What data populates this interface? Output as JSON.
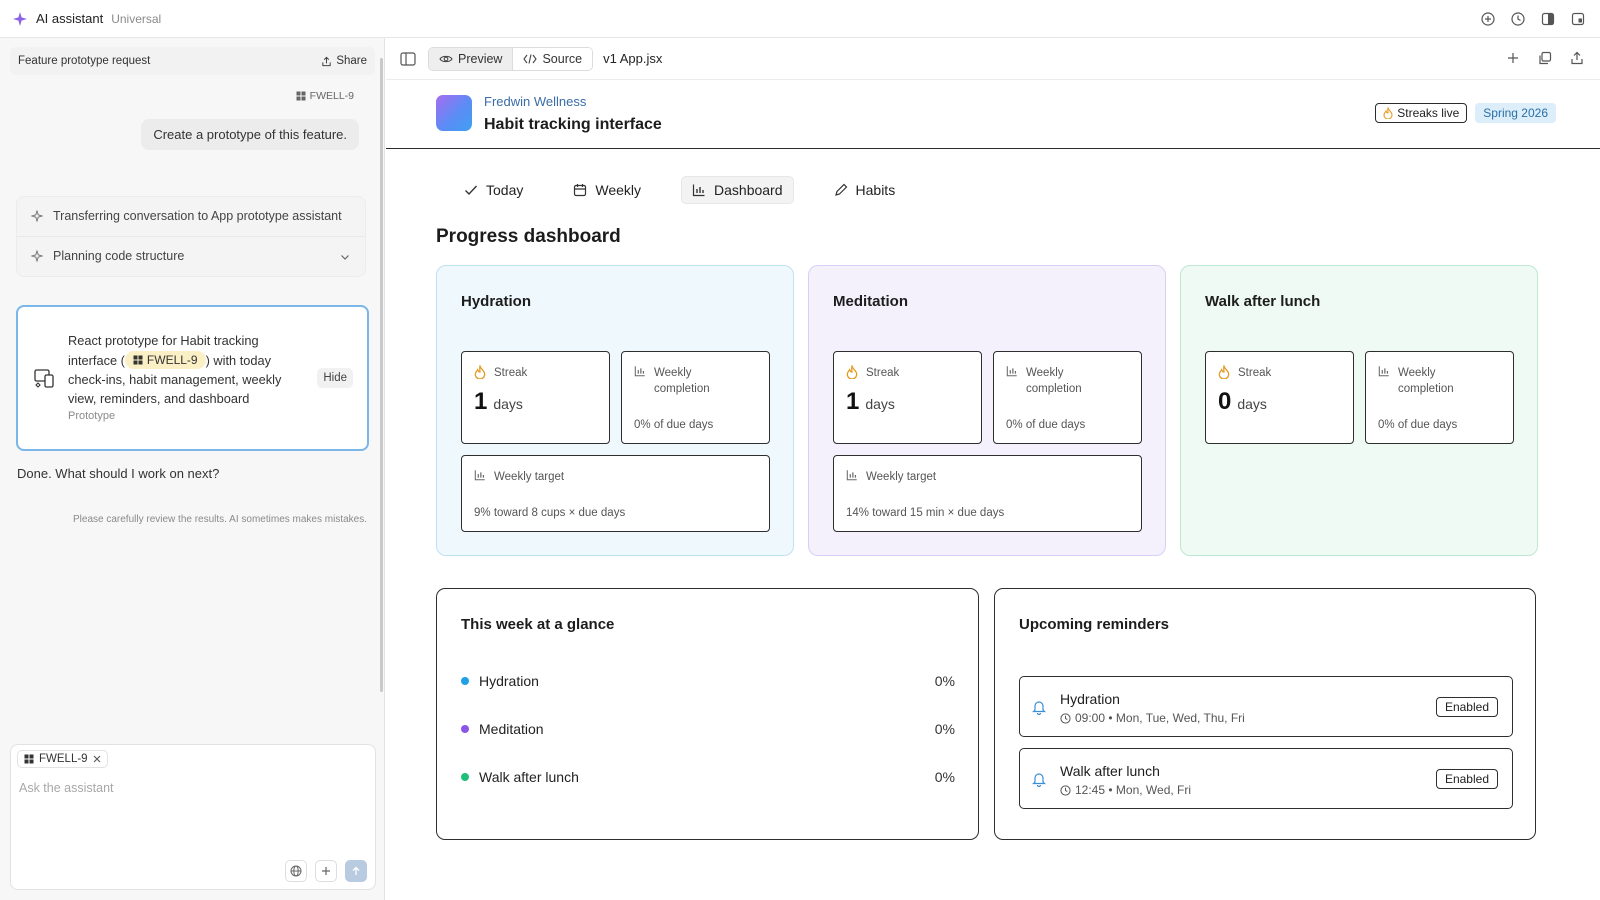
{
  "app": {
    "title": "AI assistant",
    "subtitle": "Universal"
  },
  "sidebar": {
    "conversation_title": "Feature prototype request",
    "share_label": "Share",
    "ticket_tag": "FWELL-9",
    "user_message": "Create a prototype of this feature.",
    "steps": [
      {
        "label": "Transferring conversation to App prototype assistant"
      },
      {
        "label": "Planning code structure"
      }
    ],
    "prototype_card": {
      "text_before": "React prototype for Habit tracking interface (",
      "tag": "FWELL-9",
      "text_after": ") with today check-ins, habit management, weekly view, reminders, and dashboard",
      "type_label": "Prototype",
      "hide_label": "Hide"
    },
    "assistant_reply": "Done. What should I work on next?",
    "disclaimer": "Please carefully review the results. AI sometimes makes mistakes.",
    "composer": {
      "chip": "FWELL-9",
      "placeholder": "Ask the assistant"
    }
  },
  "toolbar": {
    "preview_label": "Preview",
    "source_label": "Source",
    "file_name": "v1 App.jsx"
  },
  "app_header": {
    "org": "Fredwin Wellness",
    "title": "Habit tracking interface",
    "badge_streaks": "Streaks live",
    "badge_season": "Spring 2026"
  },
  "tabs": [
    {
      "label": "Today",
      "icon": "check-icon"
    },
    {
      "label": "Weekly",
      "icon": "calendar-icon"
    },
    {
      "label": "Dashboard",
      "icon": "bar-chart-icon",
      "active": true
    },
    {
      "label": "Habits",
      "icon": "pencil-icon"
    }
  ],
  "dashboard": {
    "title": "Progress dashboard",
    "streak_label": "Streak",
    "days_label": "days",
    "weekly_label": "Weekly completion",
    "target_label": "Weekly target",
    "habits": [
      {
        "name": "Hydration",
        "streak": "1",
        "weekly": "0% of due days",
        "target": "9% toward 8 cups × due days"
      },
      {
        "name": "Meditation",
        "streak": "1",
        "weekly": "0% of due days",
        "target": "14% toward 15 min × due days"
      },
      {
        "name": "Walk after lunch",
        "streak": "0",
        "weekly": "0% of due days"
      }
    ],
    "glance": {
      "title": "This week at a glance",
      "rows": [
        {
          "name": "Hydration",
          "pct": "0%",
          "color": "#1ea0e6"
        },
        {
          "name": "Meditation",
          "pct": "0%",
          "color": "#8b55e8"
        },
        {
          "name": "Walk after lunch",
          "pct": "0%",
          "color": "#1fbf7a"
        }
      ]
    },
    "reminders": {
      "title": "Upcoming reminders",
      "items": [
        {
          "name": "Hydration",
          "schedule": "09:00 • Mon, Tue, Wed, Thu, Fri",
          "status": "Enabled"
        },
        {
          "name": "Walk after lunch",
          "schedule": "12:45 • Mon, Wed, Fri",
          "status": "Enabled"
        }
      ]
    }
  }
}
